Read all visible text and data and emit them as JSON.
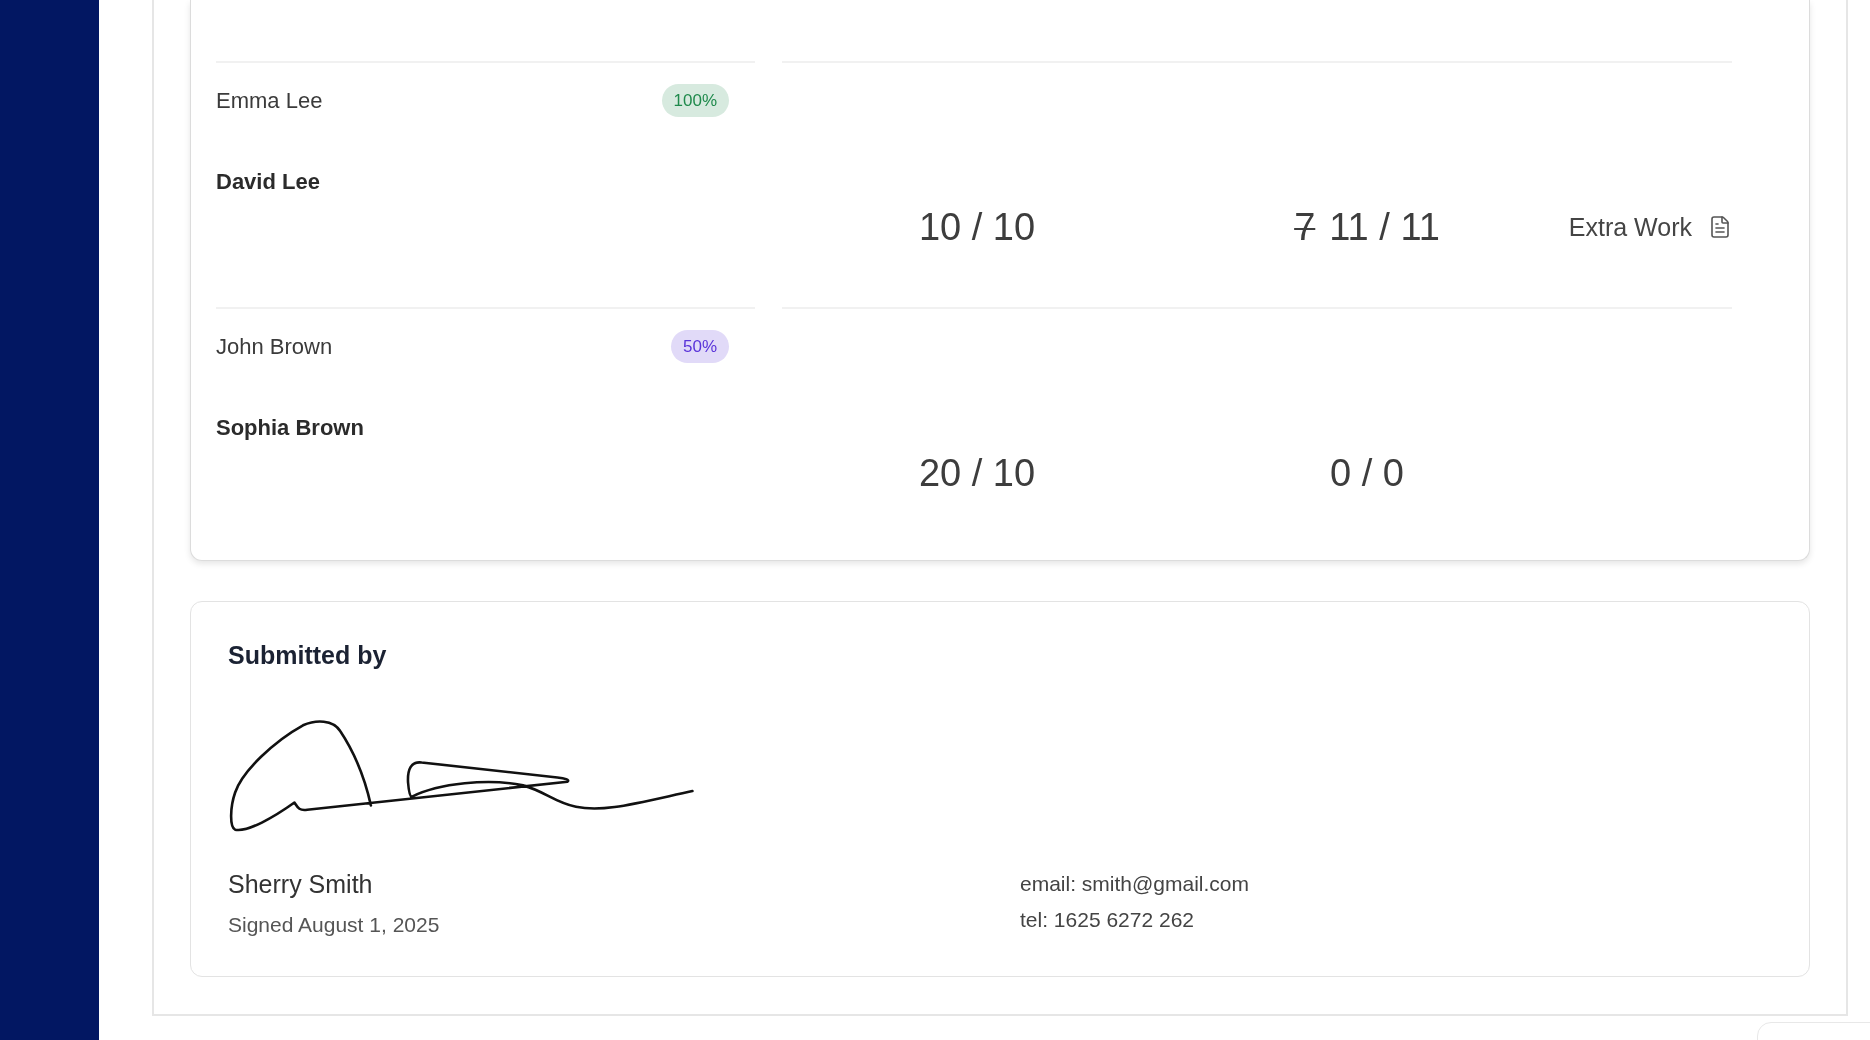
{
  "score_rows": [
    {
      "parent": "Emma Lee",
      "completion": {
        "label": "100%",
        "color": "#1f8a4c"
      },
      "student": "David Lee",
      "scores": [
        {
          "value": "10 / 10"
        },
        {
          "previous": "7",
          "value": "11 / 11"
        }
      ],
      "attachment": "Extra Work"
    },
    {
      "parent": "John Brown",
      "completion": {
        "label": "50%",
        "color": "#5a34d9"
      },
      "student": "Sophia Brown",
      "scores": [
        {
          "value": "20 / 10"
        },
        {
          "value": "0 / 0"
        }
      ]
    }
  ],
  "submission": {
    "title": "Submitted by",
    "signer": "Sherry Smith",
    "signed": "Signed August 1, 2025",
    "email": "email: smith@gmail.com",
    "phone": "tel: 1625 6272 262"
  }
}
